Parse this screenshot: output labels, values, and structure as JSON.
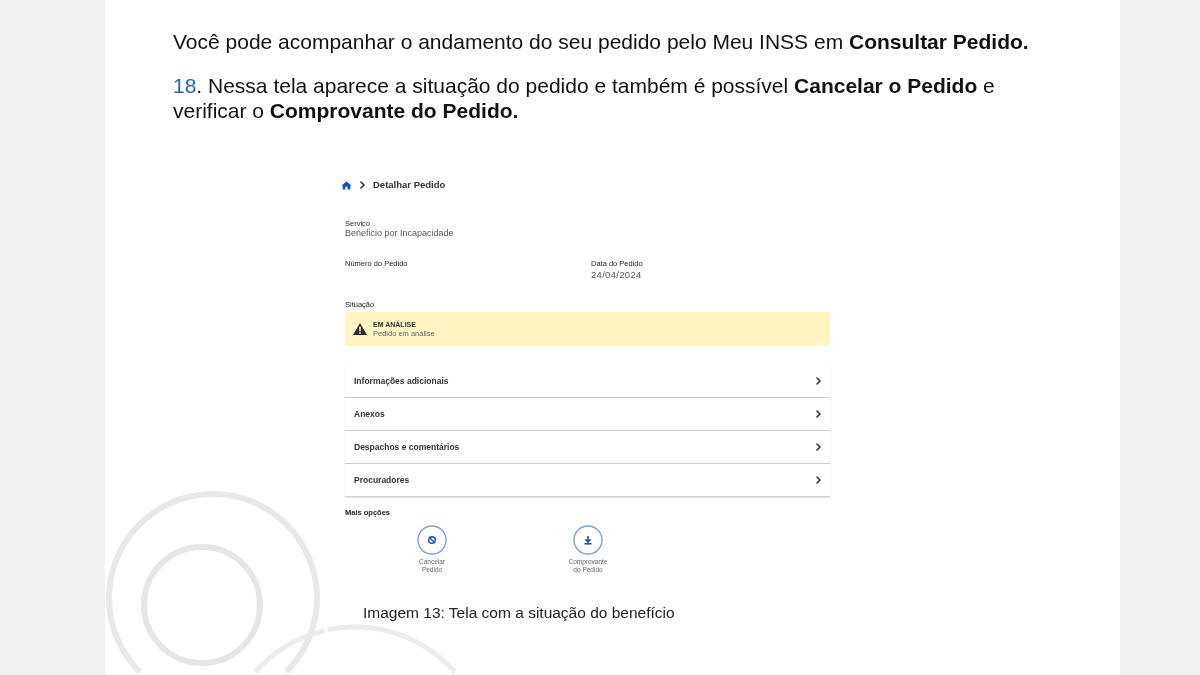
{
  "document": {
    "paragraphs": [
      {
        "text": "Você pode acompanhar o andamento do seu pedido pelo Meu INSS em **Consultar Pedido.**"
      },
      {
        "step": "18",
        "text": ". Nessa tela aparece a situação do pedido e também é possível **Cancelar o Pedido** e verificar o **Comprovante do Pedido.**"
      }
    ],
    "screenshot": {
      "breadcrumb": {
        "current": "Detalhar Pedido"
      },
      "service": {
        "label": "Servico",
        "value": "Beneficio por Incapacidade"
      },
      "details": [
        {
          "label": "Número do Pedido"
        },
        {
          "label": "Data do Pedido",
          "value": "24/04/2024"
        }
      ],
      "status": {
        "label": "Situação",
        "title": "EM ANÁLISE",
        "description": "Pedido em análise"
      },
      "sections": [
        "Informações adicionais",
        "Anexos",
        "Despachos e comentários",
        "Procuradores"
      ],
      "more_options": {
        "label": "Mais opções",
        "actions": [
          {
            "kind": "cancel",
            "label": "Cancelar Pedido"
          },
          {
            "kind": "download",
            "label": "Comprovante do Pedido"
          }
        ]
      }
    },
    "caption": "Imagem 13: Tela com a situação do benefício"
  }
}
